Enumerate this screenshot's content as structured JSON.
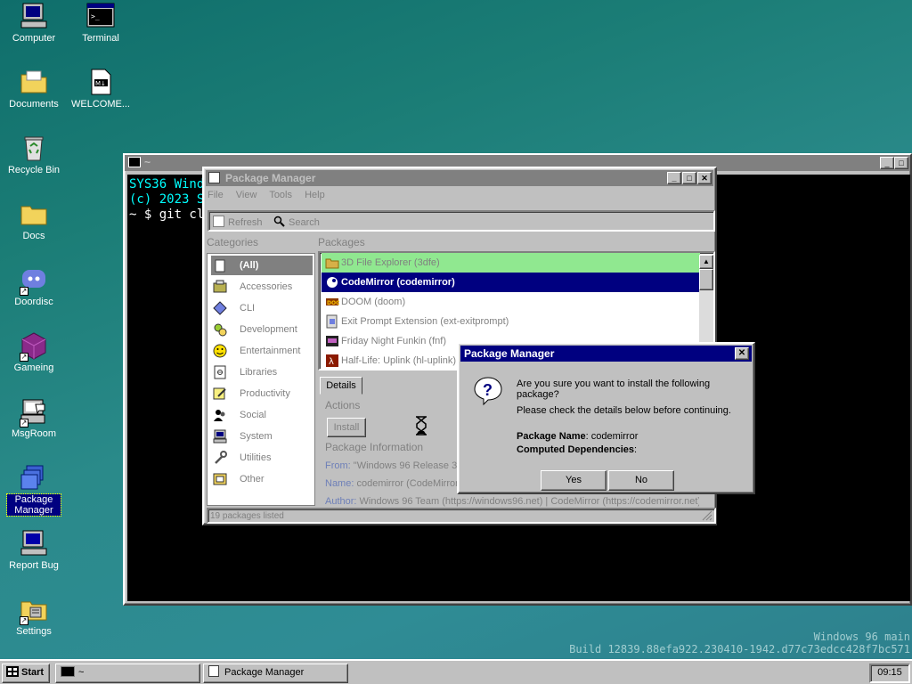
{
  "desktop": {
    "icons": [
      {
        "label": "Computer"
      },
      {
        "label": "Terminal"
      },
      {
        "label": "Documents"
      },
      {
        "label": "WELCOME..."
      },
      {
        "label": "Recycle Bin"
      },
      {
        "label": "Docs"
      },
      {
        "label": "Doordisc"
      },
      {
        "label": "Gameing"
      },
      {
        "label": "MsgRoom"
      },
      {
        "label": "Package Manager"
      },
      {
        "label": "Report Bug"
      },
      {
        "label": "Settings"
      }
    ],
    "watermark": {
      "line1": "Windows 96 main",
      "line2": "Build 12839.88efa922.230410-1942.d77c73edcc428f7bc571"
    }
  },
  "terminal": {
    "title": "~",
    "lines": [
      "SYS36 Windo",
      "(c) 2023 Sy",
      "",
      "~ $ git clo"
    ]
  },
  "package_manager": {
    "title": "Package Manager",
    "menu": [
      "File",
      "View",
      "Tools",
      "Help"
    ],
    "toolbar": {
      "refresh": "Refresh",
      "search": "Search"
    },
    "categories_label": "Categories",
    "packages_label": "Packages",
    "categories": [
      {
        "label": "(All)",
        "icon": "all-icon"
      },
      {
        "label": "Accessories",
        "icon": "accessories-icon"
      },
      {
        "label": "CLI",
        "icon": "cli-icon"
      },
      {
        "label": "Development",
        "icon": "development-icon"
      },
      {
        "label": "Entertainment",
        "icon": "entertainment-icon"
      },
      {
        "label": "Libraries",
        "icon": "libraries-icon"
      },
      {
        "label": "Productivity",
        "icon": "productivity-icon"
      },
      {
        "label": "Social",
        "icon": "social-icon"
      },
      {
        "label": "System",
        "icon": "system-icon"
      },
      {
        "label": "Utilities",
        "icon": "utilities-icon"
      },
      {
        "label": "Other",
        "icon": "other-icon"
      }
    ],
    "packages": [
      {
        "label": "3D File Explorer (3dfe)"
      },
      {
        "label": "CodeMirror (codemirror)"
      },
      {
        "label": "DOOM (doom)"
      },
      {
        "label": "Exit Prompt Extension (ext-exitprompt)"
      },
      {
        "label": "Friday Night Funkin (fnf)"
      },
      {
        "label": "Half-Life: Uplink (hl-uplink)"
      }
    ],
    "details": {
      "tab": "Details",
      "actions_label": "Actions",
      "install": "Install",
      "info_label": "Package Information",
      "from_key": "From:",
      "from_value": "\"Windows 96 Release 3",
      "name_key": "Name:",
      "name_value": "codemirror (CodeMirror)",
      "author_key": "Author:",
      "author_value": "Windows 96 Team (https://windows96.net) | CodeMirror (https://codemirror.net)"
    },
    "status": "19 packages listed"
  },
  "dialog": {
    "title": "Package Manager",
    "question": "Are you sure you want to install the following package?",
    "note": "Please check the details below before continuing.",
    "pkg_name_key": "Package Name",
    "pkg_name_value": ": codemirror",
    "deps_key": "Computed Dependencies",
    "deps_value": ":",
    "yes": "Yes",
    "no": "No"
  },
  "taskbar": {
    "start": "Start",
    "tasks": [
      {
        "label": "~"
      },
      {
        "label": "Package Manager"
      }
    ],
    "clock": "09:15"
  }
}
